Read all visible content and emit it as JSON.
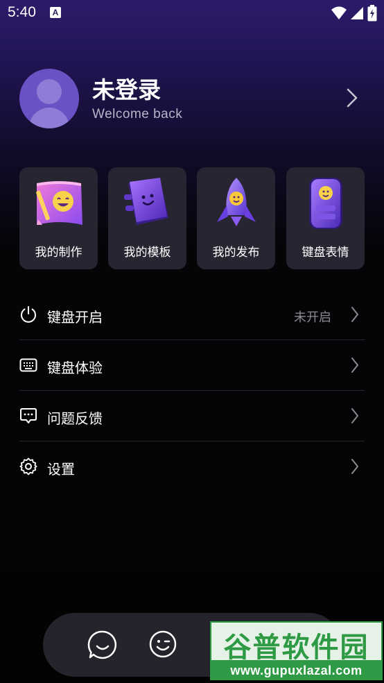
{
  "status_bar": {
    "time": "5:40",
    "notification_badge": "A"
  },
  "profile": {
    "name": "未登录",
    "subtitle": "Welcome back"
  },
  "features": [
    {
      "label": "我的制作",
      "icon": "smiley-notebook-icon"
    },
    {
      "label": "我的模板",
      "icon": "purple-book-icon"
    },
    {
      "label": "我的发布",
      "icon": "rocket-icon"
    },
    {
      "label": "键盘表情",
      "icon": "emoji-phone-icon"
    }
  ],
  "menu": [
    {
      "label": "键盘开启",
      "status": "未开启",
      "icon": "power-icon"
    },
    {
      "label": "键盘体验",
      "status": "",
      "icon": "keyboard-icon"
    },
    {
      "label": "问题反馈",
      "status": "",
      "icon": "feedback-icon"
    },
    {
      "label": "设置",
      "status": "",
      "icon": "gear-icon"
    }
  ],
  "bottom_nav": {
    "tabs": [
      "chat-bubble-icon",
      "wink-face-icon",
      "home-center-icon"
    ]
  },
  "watermark": {
    "title": "谷普软件园",
    "url": "www.gupuxlazal.com"
  },
  "colors": {
    "accent": "#6b52c4",
    "card_bg": "#262531",
    "muted_text": "#8a8a90"
  }
}
